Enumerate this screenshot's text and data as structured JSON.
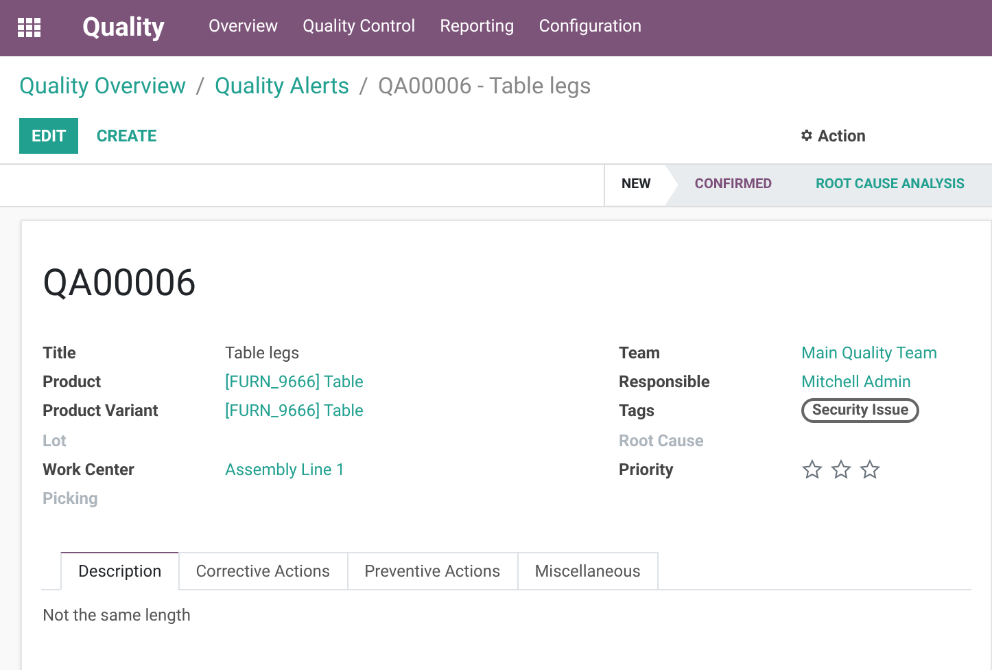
{
  "navbar": {
    "app_title": "Quality",
    "menu": [
      "Overview",
      "Quality Control",
      "Reporting",
      "Configuration"
    ]
  },
  "breadcrumbs": [
    {
      "label": "Quality Overview",
      "kind": "link"
    },
    {
      "label": "Quality Alerts",
      "kind": "link"
    },
    {
      "label": "QA00006 - Table legs",
      "kind": "current"
    }
  ],
  "separator": "/",
  "buttons": {
    "edit": "EDIT",
    "create": "CREATE",
    "action": "Action"
  },
  "stages": [
    {
      "label": "NEW",
      "selected": true,
      "color": "#212529"
    },
    {
      "label": "CONFIRMED",
      "selected": false,
      "color": "#7c4f7a"
    },
    {
      "label": "ROOT CAUSE ANALYSIS",
      "selected": false,
      "color": "#21a090"
    }
  ],
  "record": {
    "name": "QA00006",
    "left_fields": [
      {
        "label": "Title",
        "value": "Table legs",
        "kind": "text"
      },
      {
        "label": "Product",
        "value": "[FURN_9666] Table",
        "kind": "link"
      },
      {
        "label": "Product Variant",
        "value": "[FURN_9666] Table",
        "kind": "link"
      },
      {
        "label": "Lot",
        "kind": "empty"
      },
      {
        "label": "Work Center",
        "value": "Assembly Line 1",
        "kind": "link"
      },
      {
        "label": "Picking",
        "kind": "empty"
      }
    ],
    "right_fields": [
      {
        "label": "Team",
        "value": "Main Quality Team",
        "kind": "link"
      },
      {
        "label": "Responsible",
        "value": "Mitchell Admin",
        "kind": "link"
      },
      {
        "label": "Tags",
        "value": "Security Issue",
        "kind": "tag"
      },
      {
        "label": "Root Cause",
        "kind": "empty"
      },
      {
        "label": "Priority",
        "kind": "stars",
        "stars": 0
      }
    ]
  },
  "tabs": [
    {
      "label": "Description",
      "selected": true
    },
    {
      "label": "Corrective Actions",
      "selected": false
    },
    {
      "label": "Preventive Actions",
      "selected": false
    },
    {
      "label": "Miscellaneous",
      "selected": false
    }
  ],
  "description": "Not the same length"
}
